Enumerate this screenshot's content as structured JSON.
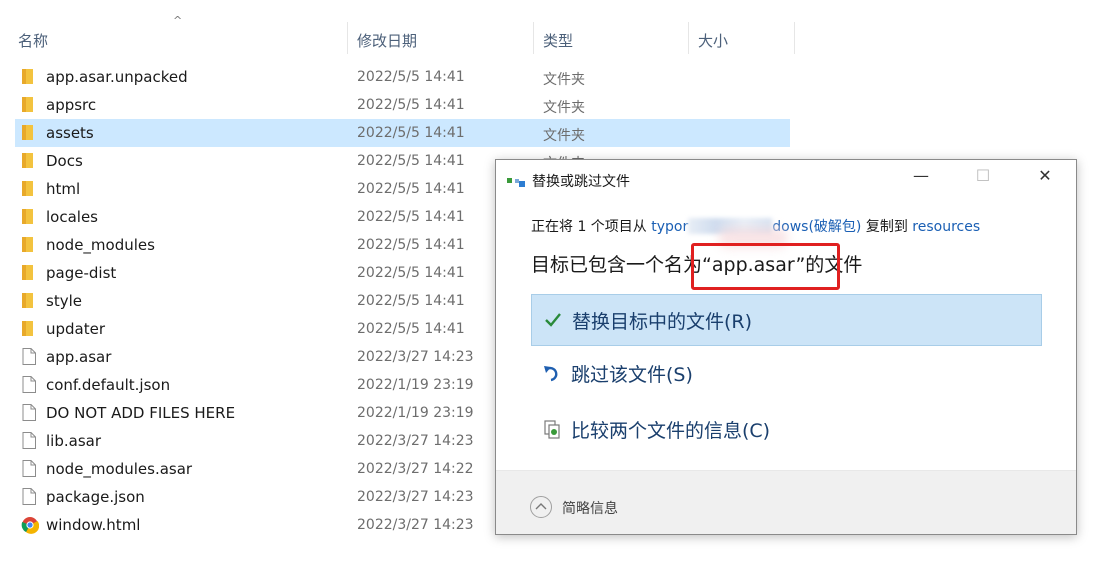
{
  "explorer": {
    "columns": {
      "name": "名称",
      "date": "修改日期",
      "type": "类型",
      "size": "大小"
    },
    "sort_indicator": "^",
    "files": [
      {
        "name": "app.asar.unpacked",
        "date": "2022/5/5 14:41",
        "type": "文件夹",
        "icon": "folder-icon"
      },
      {
        "name": "appsrc",
        "date": "2022/5/5 14:41",
        "type": "文件夹",
        "icon": "folder-icon"
      },
      {
        "name": "assets",
        "date": "2022/5/5 14:41",
        "type": "文件夹",
        "icon": "folder-icon",
        "selected": true
      },
      {
        "name": "Docs",
        "date": "2022/5/5 14:41",
        "type": "文件夹",
        "icon": "folder-icon"
      },
      {
        "name": "html",
        "date": "2022/5/5 14:41",
        "type": "",
        "icon": "folder-icon"
      },
      {
        "name": "locales",
        "date": "2022/5/5 14:41",
        "type": "",
        "icon": "folder-icon"
      },
      {
        "name": "node_modules",
        "date": "2022/5/5 14:41",
        "type": "",
        "icon": "folder-icon"
      },
      {
        "name": "page-dist",
        "date": "2022/5/5 14:41",
        "type": "",
        "icon": "folder-icon"
      },
      {
        "name": "style",
        "date": "2022/5/5 14:41",
        "type": "",
        "icon": "folder-icon"
      },
      {
        "name": "updater",
        "date": "2022/5/5 14:41",
        "type": "",
        "icon": "folder-icon"
      },
      {
        "name": "app.asar",
        "date": "2022/3/27 14:23",
        "type": "",
        "icon": "file-icon"
      },
      {
        "name": "conf.default.json",
        "date": "2022/1/19 23:19",
        "type": "",
        "icon": "file-icon"
      },
      {
        "name": "DO NOT ADD FILES HERE",
        "date": "2022/1/19 23:19",
        "type": "",
        "icon": "file-icon"
      },
      {
        "name": "lib.asar",
        "date": "2022/3/27 14:23",
        "type": "",
        "icon": "file-icon"
      },
      {
        "name": "node_modules.asar",
        "date": "2022/3/27 14:22",
        "type": "",
        "icon": "file-icon"
      },
      {
        "name": "package.json",
        "date": "2022/3/27 14:23",
        "type": "",
        "icon": "file-icon"
      },
      {
        "name": "window.html",
        "date": "2022/3/27 14:23",
        "type": "",
        "icon": "chrome-icon"
      }
    ]
  },
  "dialog": {
    "title": "替换或跳过文件",
    "window_buttons": {
      "minimize": "—",
      "maximize": "☐",
      "close": "✕"
    },
    "source_prefix": "正在将 1 个项目从 ",
    "source_start": "typor",
    "source_end": "dows(破解包)",
    "copy_to": " 复制到 ",
    "destination": "resources",
    "headline_before": "目标已包含一个名",
    "headline_highlight": "为“app.asar”的",
    "headline_after": "文件",
    "options": {
      "replace": "替换目标中的文件(R)",
      "skip": "跳过该文件(S)",
      "compare": "比较两个文件的信息(C)"
    },
    "footer": "简略信息",
    "colors": {
      "accent": "#1a5fb4",
      "selection": "#cce4f7",
      "highlight_border": "#e02020"
    }
  }
}
